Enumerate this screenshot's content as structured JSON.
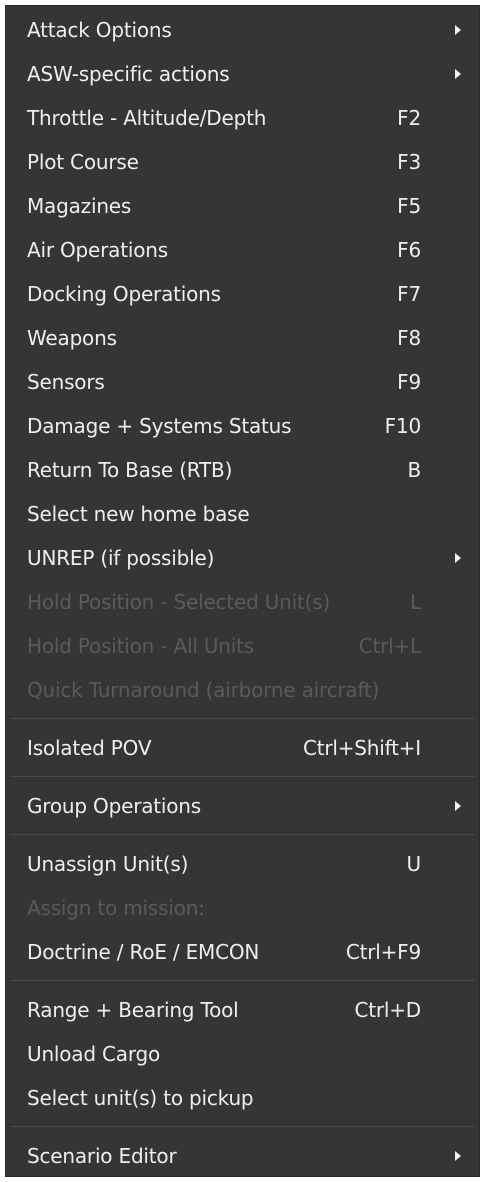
{
  "menu": {
    "items": [
      {
        "label": "Attack Options",
        "shortcut": "",
        "submenu": true,
        "disabled": false
      },
      {
        "label": "ASW-specific actions",
        "shortcut": "",
        "submenu": true,
        "disabled": false
      },
      {
        "label": "Throttle - Altitude/Depth",
        "shortcut": "F2",
        "submenu": false,
        "disabled": false
      },
      {
        "label": "Plot Course",
        "shortcut": "F3",
        "submenu": false,
        "disabled": false
      },
      {
        "label": "Magazines",
        "shortcut": "F5",
        "submenu": false,
        "disabled": false
      },
      {
        "label": "Air Operations",
        "shortcut": "F6",
        "submenu": false,
        "disabled": false
      },
      {
        "label": "Docking Operations",
        "shortcut": "F7",
        "submenu": false,
        "disabled": false
      },
      {
        "label": "Weapons",
        "shortcut": "F8",
        "submenu": false,
        "disabled": false
      },
      {
        "label": "Sensors",
        "shortcut": "F9",
        "submenu": false,
        "disabled": false
      },
      {
        "label": "Damage + Systems Status",
        "shortcut": "F10",
        "submenu": false,
        "disabled": false
      },
      {
        "label": "Return To Base (RTB)",
        "shortcut": "B",
        "submenu": false,
        "disabled": false
      },
      {
        "label": "Select new home base",
        "shortcut": "",
        "submenu": false,
        "disabled": false
      },
      {
        "label": "UNREP (if possible)",
        "shortcut": "",
        "submenu": true,
        "disabled": false
      },
      {
        "label": "Hold Position - Selected Unit(s)",
        "shortcut": "L",
        "submenu": false,
        "disabled": true
      },
      {
        "label": "Hold Position - All Units",
        "shortcut": "Ctrl+L",
        "submenu": false,
        "disabled": true
      },
      {
        "label": "Quick Turnaround (airborne aircraft)",
        "shortcut": "",
        "submenu": false,
        "disabled": true
      },
      {
        "label": "Isolated POV",
        "shortcut": "Ctrl+Shift+I",
        "submenu": false,
        "disabled": false
      },
      {
        "label": "Group Operations",
        "shortcut": "",
        "submenu": true,
        "disabled": false
      },
      {
        "label": "Unassign Unit(s)",
        "shortcut": "U",
        "submenu": false,
        "disabled": false
      },
      {
        "label": "Assign to mission:",
        "shortcut": "",
        "submenu": false,
        "disabled": true
      },
      {
        "label": "Doctrine / RoE / EMCON",
        "shortcut": "Ctrl+F9",
        "submenu": false,
        "disabled": false
      },
      {
        "label": "Range + Bearing Tool",
        "shortcut": "Ctrl+D",
        "submenu": false,
        "disabled": false
      },
      {
        "label": "Unload Cargo",
        "shortcut": "",
        "submenu": false,
        "disabled": false
      },
      {
        "label": "Select unit(s) to pickup",
        "shortcut": "",
        "submenu": false,
        "disabled": false
      },
      {
        "label": "Scenario Editor",
        "shortcut": "",
        "submenu": true,
        "disabled": false
      }
    ]
  }
}
